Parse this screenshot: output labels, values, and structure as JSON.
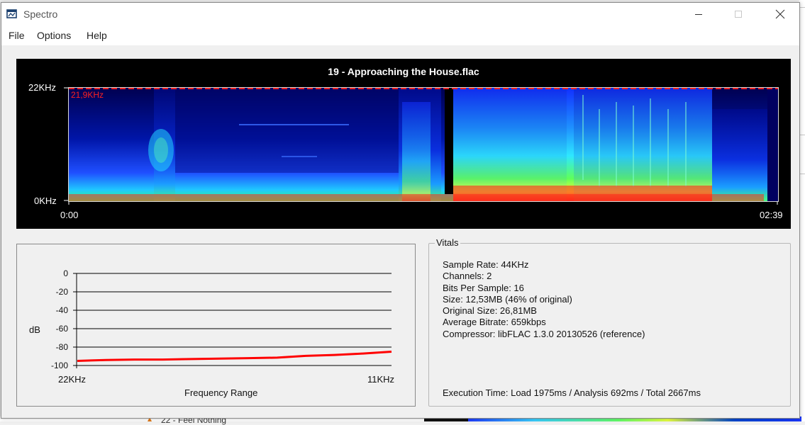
{
  "window": {
    "title": "Spectro",
    "controls": {
      "minimize": "minimize-icon",
      "maximize": "maximize-icon",
      "close": "close-icon"
    }
  },
  "menu": {
    "file": "File",
    "options": "Options",
    "help": "Help"
  },
  "spectrogram": {
    "file_title": "19 - Approaching the House.flac",
    "y_top_label": "22KHz",
    "y_bottom_label": "0KHz",
    "x_start_label": "0:00",
    "x_end_label": "02:39",
    "peak_label": "21,9KHz",
    "colors": {
      "background": "#000000",
      "peak_line": "#ff2020",
      "low": "#000064",
      "mid": "#1e6bff",
      "high": "#33ff66",
      "max": "#ff1a1a"
    }
  },
  "frequency_chart": {
    "y_axis_label": "dB",
    "y_ticks": [
      "0",
      "-20",
      "-40",
      "-60",
      "-80",
      "-100"
    ],
    "x_start_label": "22KHz",
    "x_end_label": "11KHz",
    "x_axis_title": "Frequency Range",
    "line_color": "#ff0000"
  },
  "chart_data": {
    "type": "line",
    "xlabel": "Frequency Range",
    "ylabel": "dB",
    "ylim": [
      -100,
      0
    ],
    "x_range_labels": [
      "22KHz",
      "11KHz"
    ],
    "x": [
      22,
      21,
      20,
      19,
      18,
      17,
      16,
      15,
      14,
      13,
      12,
      11
    ],
    "series": [
      {
        "values": [
          -95,
          -94,
          -93.5,
          -93.5,
          -93,
          -92.5,
          -92,
          -91.5,
          -89.5,
          -88.5,
          -87,
          -85
        ]
      }
    ]
  },
  "vitals": {
    "group_title": "Vitals",
    "lines": [
      "Sample Rate: 44KHz",
      "Channels: 2",
      "Bits Per Sample: 16",
      "Size: 12,53MB (46% of original)",
      "Original Size: 26,81MB",
      "Average Bitrate: 659kbps",
      "Compressor: libFLAC 1.3.0 20130526 (reference)"
    ],
    "execution_time": "Execution Time: Load 1975ms / Analysis 692ms / Total 2667ms"
  },
  "background": {
    "taskbar_item": "22 - Feel Nothing"
  }
}
